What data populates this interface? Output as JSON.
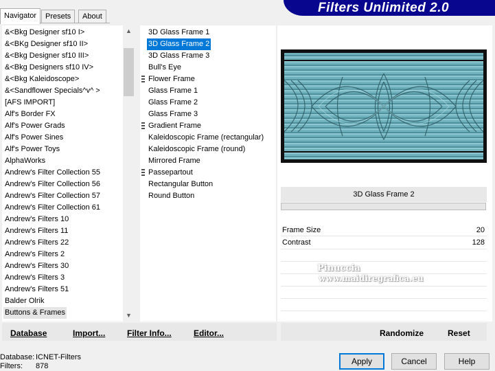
{
  "banner": {
    "title": "Filters Unlimited 2.0"
  },
  "tabs": [
    {
      "label": "Navigator",
      "active": true
    },
    {
      "label": "Presets",
      "active": false
    },
    {
      "label": "About",
      "active": false
    }
  ],
  "categories": [
    "&<Bkg Designer sf10 I>",
    "&<BKg Designer sf10 II>",
    "&<Bkg Designer sf10 III>",
    "&<Bkg Designers sf10 IV>",
    "&<Bkg Kaleidoscope>",
    "&<Sandflower Specials^v^ >",
    "[AFS IMPORT]",
    "Alf's Border FX",
    "Alf's Power Grads",
    "Alf's Power Sines",
    "Alf's Power Toys",
    "AlphaWorks",
    "Andrew's Filter Collection 55",
    "Andrew's Filter Collection 56",
    "Andrew's Filter Collection 57",
    "Andrew's Filter Collection 61",
    "Andrew's Filters 10",
    "Andrew's Filters 11",
    "Andrew's Filters 22",
    "Andrew's Filters 2",
    "Andrew's Filters 30",
    "Andrew's Filters 3",
    "Andrew's Filters 51",
    "Balder Olrik",
    "Buttons & Frames"
  ],
  "selected_category": "Buttons & Frames",
  "filters": [
    {
      "label": "3D Glass Frame 1",
      "grip": false
    },
    {
      "label": "3D Glass Frame 2",
      "grip": false,
      "selected": true
    },
    {
      "label": "3D Glass Frame 3",
      "grip": false
    },
    {
      "label": "Bull's Eye",
      "grip": false
    },
    {
      "label": "Flower Frame",
      "grip": true
    },
    {
      "label": "Glass Frame 1",
      "grip": false
    },
    {
      "label": "Glass Frame 2",
      "grip": false
    },
    {
      "label": "Glass Frame 3",
      "grip": false
    },
    {
      "label": "Gradient Frame",
      "grip": true
    },
    {
      "label": "Kaleidoscopic Frame (rectangular)",
      "grip": false
    },
    {
      "label": "Kaleidoscopic Frame (round)",
      "grip": false
    },
    {
      "label": "Mirrored Frame",
      "grip": false
    },
    {
      "label": "Passepartout",
      "grip": true
    },
    {
      "label": "Rectangular Button",
      "grip": false
    },
    {
      "label": "Round Button",
      "grip": false
    }
  ],
  "preview": {
    "filter_name": "3D Glass Frame 2"
  },
  "params": [
    {
      "label": "Frame Size",
      "value": "20"
    },
    {
      "label": "Contrast",
      "value": "128"
    }
  ],
  "watermark": {
    "line1": "Pinuccia",
    "line2": "www.maidiregrafica.eu"
  },
  "bottom_links": {
    "database": "Database",
    "import": "Import...",
    "filter_info": "Filter Info...",
    "editor": "Editor...",
    "randomize": "Randomize",
    "reset": "Reset"
  },
  "status": {
    "database_label": "Database:",
    "database_value": "ICNET-Filters",
    "filters_label": "Filters:",
    "filters_value": "878"
  },
  "buttons": {
    "apply": "Apply",
    "cancel": "Cancel",
    "help": "Help"
  },
  "colors": {
    "banner": "#08068f",
    "selection": "#0078d7",
    "preview_teal": "#5ea2ad"
  }
}
